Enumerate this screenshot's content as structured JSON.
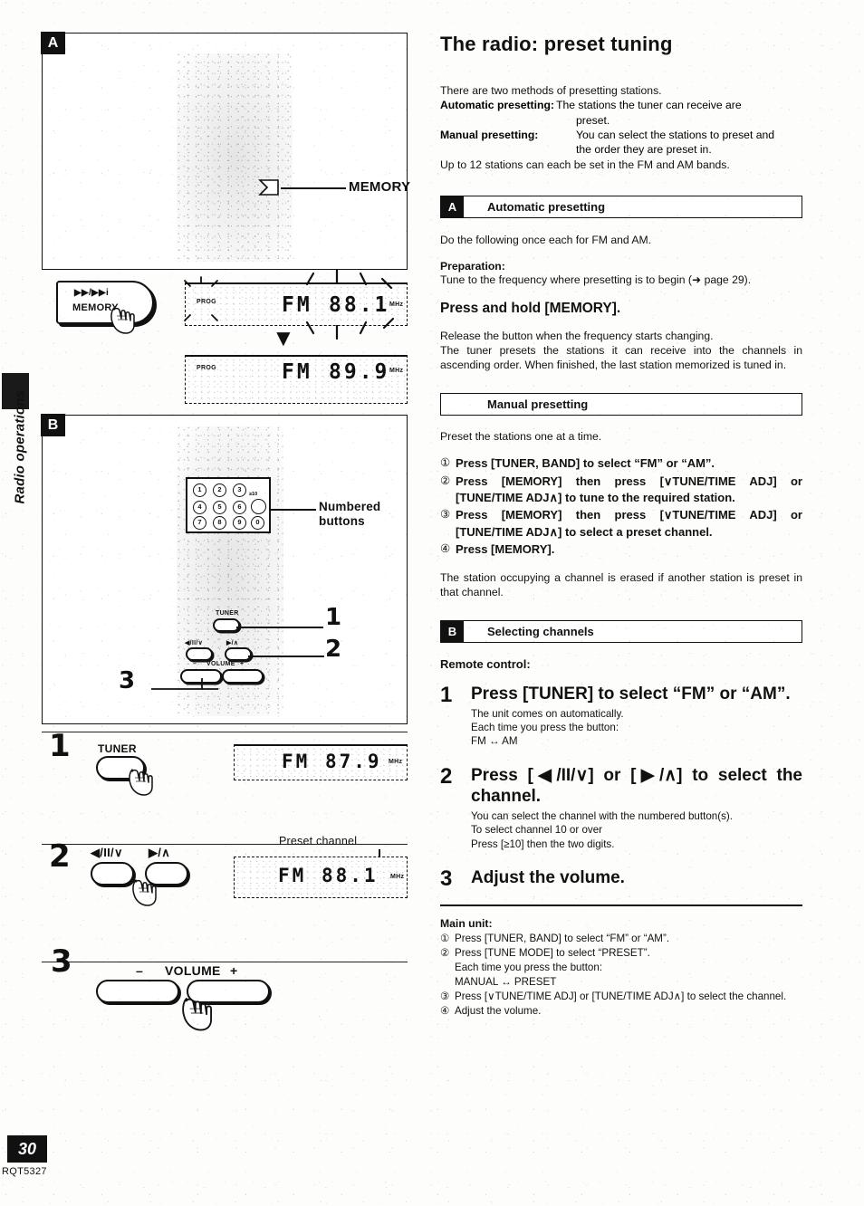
{
  "side_tab": {
    "label": "Radio operations"
  },
  "footer": {
    "page_number": "30",
    "doc_code": "RQT5327"
  },
  "left_column": {
    "panel_a": {
      "tag": "A",
      "callout_memory": "MEMORY",
      "button": {
        "transport_icons": "▶▶/▶▶i",
        "label": "MEMORY"
      },
      "display_top": {
        "indicator": "PROG",
        "band": "FM",
        "frequency": "88.1",
        "unit": "MHz",
        "state": "flashing"
      },
      "arrow": "▼",
      "display_bottom": {
        "indicator": "PROG",
        "band": "FM",
        "frequency": "89.9",
        "unit": "MHz"
      }
    },
    "panel_b": {
      "tag": "B",
      "callout_numbered_buttons": "Numbered\nbuttons",
      "keypad_keys": [
        "1",
        "2",
        "3",
        "4",
        "5",
        "6",
        "7",
        "8",
        "9",
        "0"
      ],
      "keypad_over_ten": "≥10",
      "remote_callouts": [
        "1",
        "2",
        "3"
      ],
      "remote_buttons": {
        "tuner": "TUNER",
        "left": "◀/II/∨",
        "right": "▶/∧",
        "volume_minus": "–",
        "volume_label": "VOLUME",
        "volume_plus": "+"
      }
    },
    "step_1": {
      "number": "1",
      "button_label": "TUNER",
      "display": {
        "band": "FM",
        "frequency": "87.9",
        "unit": "MHz"
      }
    },
    "step_2": {
      "number": "2",
      "button_left": "◀/II/∨",
      "button_right": "▶/∧",
      "callout": "Preset channel",
      "display": {
        "band": "FM",
        "frequency": "88.1",
        "unit": "MHz"
      }
    },
    "step_3": {
      "number": "3",
      "minus": "–",
      "label": "VOLUME",
      "plus": "+"
    }
  },
  "right_column": {
    "title": "The radio: preset tuning",
    "intro_line": "There are two methods of presetting stations.",
    "intro_rows": [
      {
        "term": "Automatic presetting:",
        "def_line1": "The stations the tuner can receive are",
        "def_line2": "preset."
      },
      {
        "term": "Manual presetting:",
        "def_line1": "You can select the stations to preset and",
        "def_line2": "the order they are preset in."
      }
    ],
    "intro_footer": "Up to 12 stations can each be set in the FM and AM bands.",
    "auto_section": {
      "tag": "A",
      "heading": "Automatic presetting",
      "intro": "Do the following once each for FM and AM.",
      "preparation_label": "Preparation:",
      "preparation_text": "Tune to the frequency where presetting is to begin (➜ page 29).",
      "action": "Press and hold [MEMORY].",
      "note_line1": "Release the button when the frequency starts changing.",
      "note_line2": "The tuner presets the stations it can receive into the channels in ascending order. When finished, the last station memorized is tuned in."
    },
    "manual_section": {
      "heading": "Manual presetting",
      "intro": "Preset the stations one at a time.",
      "steps": [
        {
          "marker": "①",
          "text": "Press [TUNER, BAND] to select “FM” or “AM”."
        },
        {
          "marker": "②",
          "text": "Press [MEMORY] then press [∨TUNE/TIME ADJ] or [TUNE/TIME ADJ∧] to tune to the required station."
        },
        {
          "marker": "③",
          "text": "Press [MEMORY] then press [∨TUNE/TIME ADJ] or [TUNE/TIME ADJ∧] to select a preset channel."
        },
        {
          "marker": "④",
          "text": "Press [MEMORY]."
        }
      ],
      "note": "The station occupying a channel is erased if another station is preset in that channel."
    },
    "select_section": {
      "tag": "B",
      "heading": "Selecting channels",
      "remote_label": "Remote control:",
      "steps": [
        {
          "number": "1",
          "title": "Press [TUNER] to select “FM” or “AM”.",
          "sub_lines": [
            "The unit comes on automatically.",
            "Each time you press the button:",
            "FM ↔ AM"
          ]
        },
        {
          "number": "2",
          "title": "Press [◀/II/∨] or [▶/∧] to select the channel.",
          "sub_lines": [
            "You can select the channel with the numbered button(s).",
            "To select channel 10 or over",
            "Press [≥10] then the two digits."
          ]
        },
        {
          "number": "3",
          "title": "Adjust the volume.",
          "sub_lines": []
        }
      ],
      "main_unit_label": "Main unit:",
      "main_unit_steps": [
        {
          "marker": "①",
          "text": "Press [TUNER, BAND] to select “FM” or “AM”."
        },
        {
          "marker": "②",
          "text": "Press [TUNE MODE] to select “PRESET”."
        },
        {
          "marker": "",
          "text": "Each time you press the button:"
        },
        {
          "marker": "",
          "text": "MANUAL ↔ PRESET"
        },
        {
          "marker": "③",
          "text": "Press [∨TUNE/TIME ADJ] or [TUNE/TIME ADJ∧] to select the channel."
        },
        {
          "marker": "④",
          "text": "Adjust the volume."
        }
      ]
    }
  }
}
